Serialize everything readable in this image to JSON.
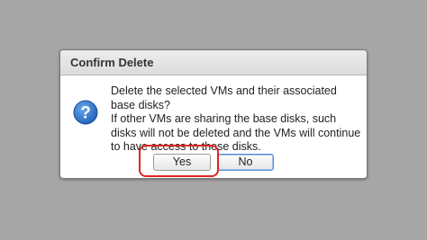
{
  "dialog": {
    "title": "Confirm Delete",
    "icon": "question-mark-icon",
    "message_line1": "Delete the selected VMs and their associated base disks?",
    "message_line2": "If other VMs are sharing the base disks, such disks will not be deleted and the VMs will continue to have access to these disks.",
    "yes_label": "Yes",
    "no_label": "No"
  },
  "colors": {
    "backdrop": "#a6a6a6",
    "icon_blue": "#2f6fc4",
    "highlight": "#e02424",
    "default_button_border": "#5b8fd0"
  }
}
